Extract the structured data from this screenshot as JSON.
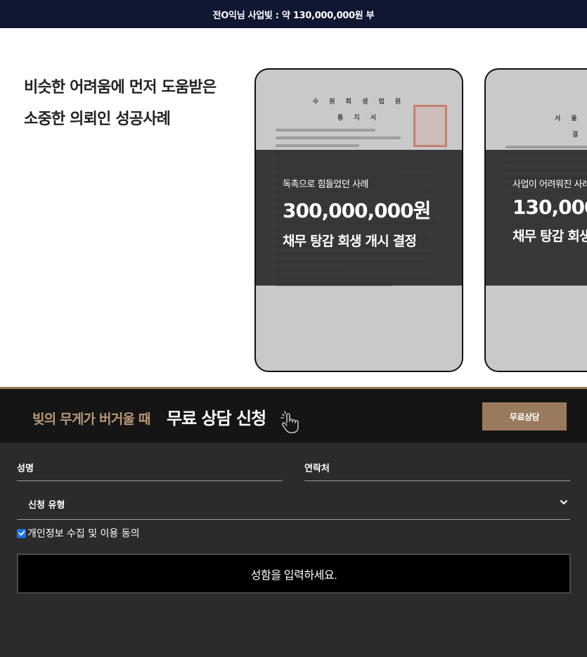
{
  "topbar": {
    "text": "전O익님 사업빚 : 약 130,000,000원 부"
  },
  "cases": {
    "heading_line1": "비슷한 어려움에 먼저 도움받은",
    "heading_line2": "소중한 의뢰인 성공사례",
    "cards": [
      {
        "doc_title_1": "수 원 회 생 법 원",
        "doc_title_2": "통 지 서",
        "sub": "독촉으로 힘들었던 사례",
        "amount": "300,000,000원",
        "result": "채무 탕감 회생 개시 결정"
      },
      {
        "doc_title_1": "서 울 회",
        "doc_title_2": "결",
        "sub": "사업이 어려워진 사례",
        "amount": "130,000",
        "result": "채무 탕감 회생"
      }
    ]
  },
  "cta": {
    "sub": "빚의 무게가 버거울 때",
    "main": "무료 상담 신청",
    "button": "무료상담"
  },
  "form": {
    "name_label": "성명",
    "contact_label": "연락처",
    "type_label": "신청 유형",
    "agree_label": "개인정보 수집 및 이용 동의",
    "submit_label": "성함을 입력하세요."
  },
  "colors": {
    "topbar": "#0f1733",
    "accent": "#9a7a5c",
    "form_bg": "#2b2b2b"
  }
}
